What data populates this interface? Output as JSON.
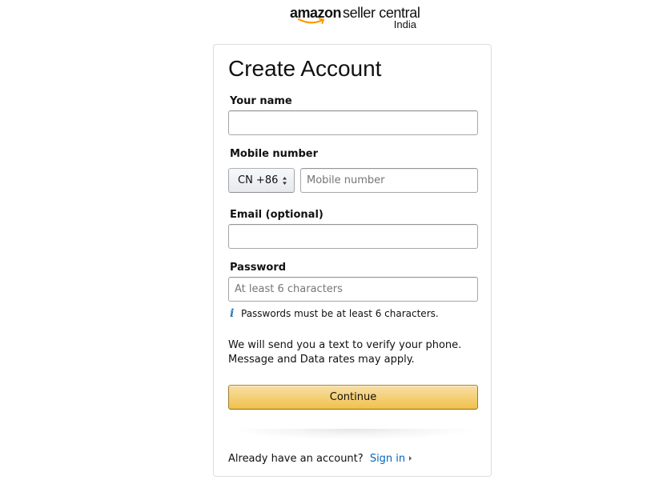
{
  "header": {
    "logo_brand": "amazon",
    "logo_product": "seller central",
    "logo_region": "India",
    "smile_color": "#f90"
  },
  "form": {
    "title": "Create Account",
    "name": {
      "label": "Your name",
      "value": "",
      "placeholder": ""
    },
    "mobile": {
      "label": "Mobile number",
      "country_code": "CN +86",
      "value": "",
      "placeholder": "Mobile number"
    },
    "email": {
      "label": "Email (optional)",
      "value": "",
      "placeholder": ""
    },
    "password": {
      "label": "Password",
      "value": "",
      "placeholder": "At least 6 characters",
      "hint_icon": "info-icon",
      "hint_icon_glyph": "i",
      "hint": "Passwords must be at least 6 characters."
    },
    "verify_notice_line1": "We will send you a text to verify your phone.",
    "verify_notice_line2": "Message and Data rates may apply.",
    "continue_label": "Continue",
    "signin_prompt": "Already have an account?",
    "signin_link": "Sign in"
  },
  "colors": {
    "link": "#0066c0",
    "button_top": "#f7dfa5",
    "button_bottom": "#f0c14b",
    "info_icon": "#2c7bb6"
  }
}
